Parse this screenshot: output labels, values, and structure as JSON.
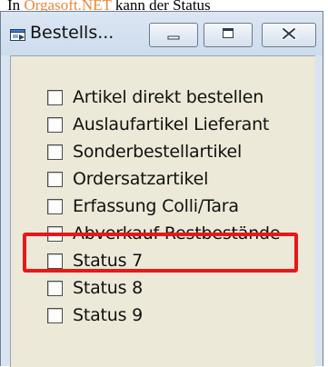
{
  "doc_text": {
    "prefix": "In ",
    "link": "Orgasoft.NET",
    "suffix": " kann der Status"
  },
  "window": {
    "title": "Bestells...",
    "icon": "app-window-icon"
  },
  "title_buttons": {
    "minimize_icon": "minimize-icon",
    "maximize_icon": "maximize-icon",
    "close_icon": "close-icon"
  },
  "checkboxes": [
    {
      "label": "Artikel direkt bestellen",
      "checked": false
    },
    {
      "label": "Auslaufartikel Lieferant",
      "checked": false
    },
    {
      "label": "Sonderbestellartikel",
      "checked": false
    },
    {
      "label": "Ordersatzartikel",
      "checked": false
    },
    {
      "label": "Erfassung Colli/Tara",
      "checked": false
    },
    {
      "label": "Abverkauf Restbestände",
      "checked": false
    },
    {
      "label": "Status 7",
      "checked": false
    },
    {
      "label": "Status 8",
      "checked": false
    },
    {
      "label": "Status 9",
      "checked": false
    }
  ],
  "colors": {
    "highlight": "#e81818",
    "link": "#e8883a",
    "client_bg": "#ece9d8",
    "frame_bg": "#d8e4f1"
  }
}
